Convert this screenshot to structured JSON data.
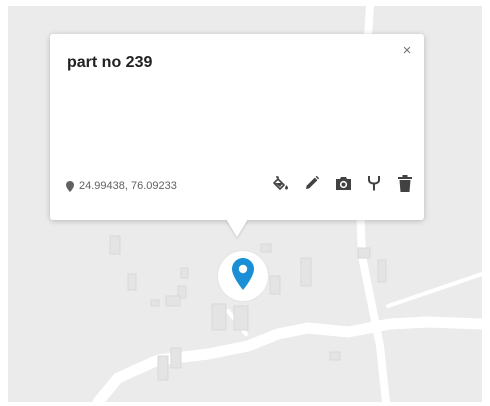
{
  "popup": {
    "title": "part no 239",
    "close_label": "×",
    "coordinates": "24.99438, 76.09233"
  },
  "toolbar": {
    "icons": [
      "paint-bucket-icon",
      "pencil-icon",
      "camera-icon",
      "fork-icon",
      "trash-icon"
    ]
  },
  "colors": {
    "map_background": "#ebebeb",
    "road": "#ffffff",
    "building": "#e3e3e3",
    "marker": "#1a8fd6",
    "icon": "#424242"
  }
}
